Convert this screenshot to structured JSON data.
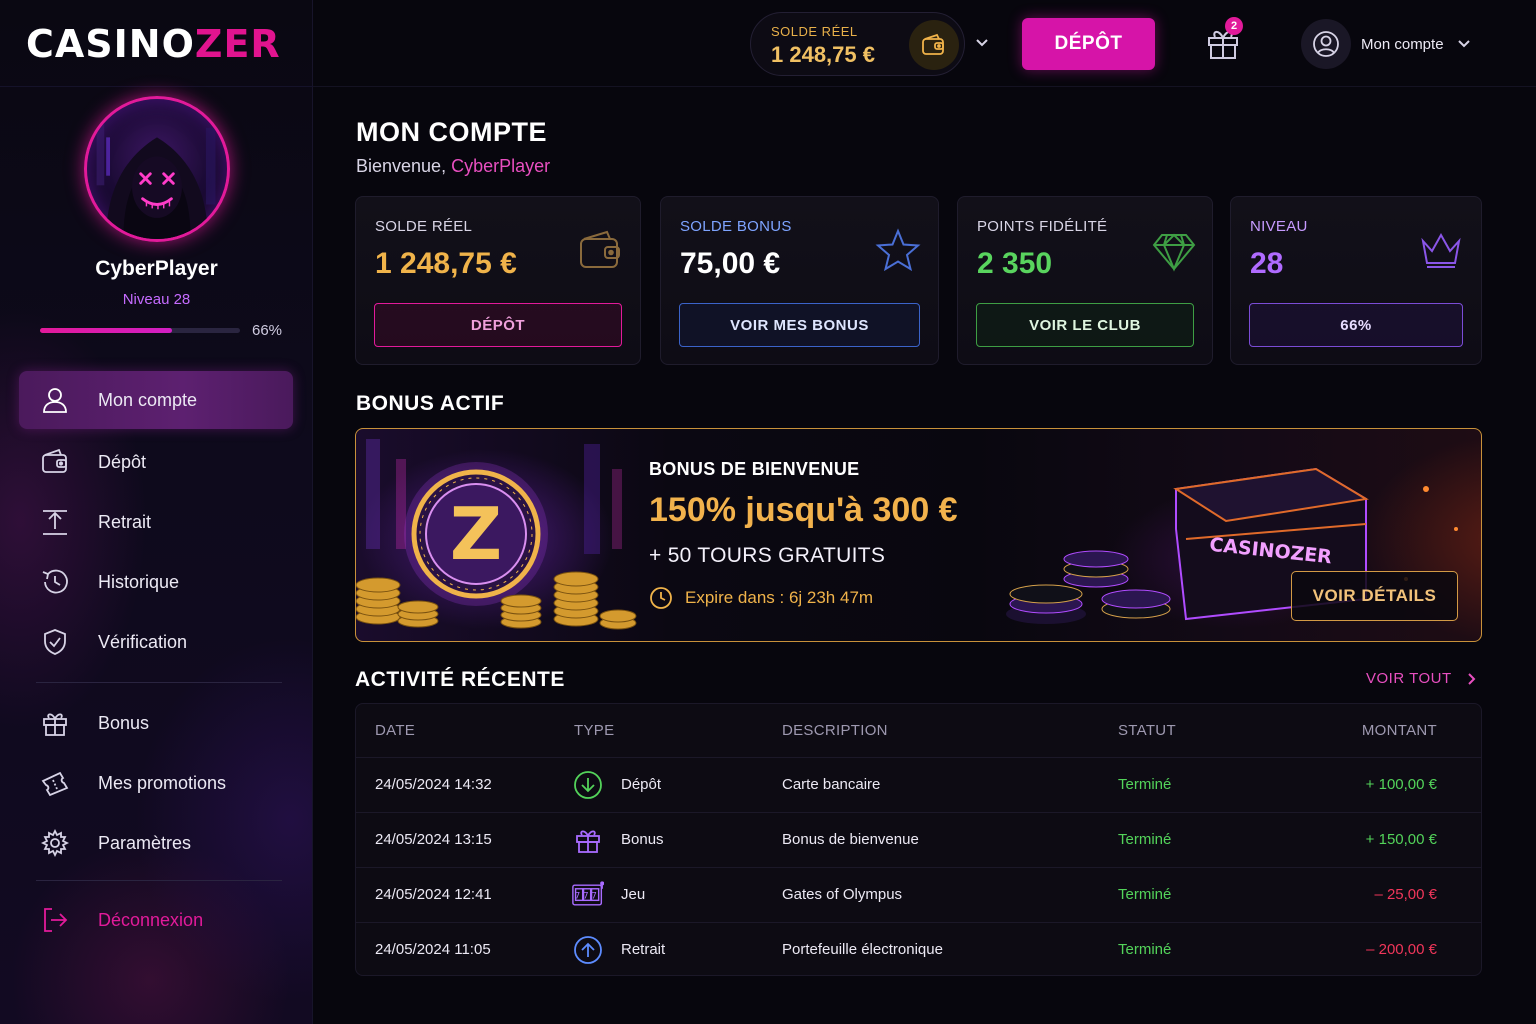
{
  "brand": {
    "logo_part1": "CASINO",
    "logo_part2": "ZER"
  },
  "topbar": {
    "wallet_label": "SOLDE RÉEL",
    "wallet_value": "1 248,75 €",
    "deposit_label": "DÉPÔT",
    "gift_badge": "2",
    "account_label": "Mon compte"
  },
  "profile": {
    "username": "CyberPlayer",
    "level_text": "Niveau 28",
    "progress_percent": 66,
    "progress_label": "66%"
  },
  "nav": {
    "items": [
      {
        "label": "Mon compte",
        "icon": "user-icon"
      },
      {
        "label": "Dépôt",
        "icon": "wallet-icon"
      },
      {
        "label": "Retrait",
        "icon": "upload-icon"
      },
      {
        "label": "Historique",
        "icon": "history-icon"
      },
      {
        "label": "Vérification",
        "icon": "shield-check-icon"
      },
      {
        "label": "Bonus",
        "icon": "gift-icon"
      },
      {
        "label": "Mes promotions",
        "icon": "ticket-icon"
      },
      {
        "label": "Paramètres",
        "icon": "gear-icon"
      }
    ],
    "logout_label": "Déconnexion"
  },
  "main": {
    "title": "MON COMPTE",
    "welcome_prefix": "Bienvenue, ",
    "welcome_name": "CyberPlayer"
  },
  "cards": [
    {
      "label": "SOLDE RÉEL",
      "value": "1 248,75 €",
      "button": "DÉPÔT",
      "icon": "wallet-icon",
      "accent": "#f0b34a",
      "button_color": "#e21a9a"
    },
    {
      "label": "SOLDE BONUS",
      "value": "75,00 €",
      "button": "VOIR MES BONUS",
      "icon": "star-icon",
      "accent": "#5d8cff",
      "button_color": "#3b63c9"
    },
    {
      "label": "POINTS FIDÉLITÉ",
      "value": "2 350",
      "button": "VOIR LE CLUB",
      "icon": "diamond-icon",
      "accent": "#59d45e",
      "button_color": "#3e9e44"
    },
    {
      "label": "NIVEAU",
      "value": "28",
      "button": "66%",
      "icon": "crown-icon",
      "accent": "#b06bff",
      "button_color": "#7b4cd6"
    }
  ],
  "bonus": {
    "section_title": "BONUS ACTIF",
    "title": "BONUS DE BIENVENUE",
    "offer": "150% jusqu'à 300 €",
    "spins": "+ 50 TOURS GRATUITS",
    "expire": "Expire dans : 6j 23h 47m",
    "button": "VOIR DÉTAILS",
    "art_coin_letter": "Z",
    "art_chest_text": "CASINOZER"
  },
  "activity": {
    "section_title": "ACTIVITÉ RÉCENTE",
    "see_all": "VOIR TOUT",
    "headers": {
      "date": "DATE",
      "type": "TYPE",
      "description": "DESCRIPTION",
      "status": "STATUT",
      "amount": "MONTANT"
    },
    "rows": [
      {
        "date": "24/05/2024 14:32",
        "type": "Dépôt",
        "icon": "deposit-arrow-icon",
        "description": "Carte bancaire",
        "status": "Terminé",
        "amount": "+ 100,00 €",
        "sign": "pos"
      },
      {
        "date": "24/05/2024 13:15",
        "type": "Bonus",
        "icon": "gift-icon",
        "description": "Bonus de bienvenue",
        "status": "Terminé",
        "amount": "+ 150,00 €",
        "sign": "pos"
      },
      {
        "date": "24/05/2024 12:41",
        "type": "Jeu",
        "icon": "slot-machine-icon",
        "slot_text": "777",
        "description": "Gates of Olympus",
        "status": "Terminé",
        "amount": "– 25,00 €",
        "sign": "neg"
      },
      {
        "date": "24/05/2024 11:05",
        "type": "Retrait",
        "icon": "withdraw-arrow-icon",
        "description": "Portefeuille électronique",
        "status": "Terminé",
        "amount": "– 200,00 €",
        "sign": "neg"
      }
    ]
  }
}
